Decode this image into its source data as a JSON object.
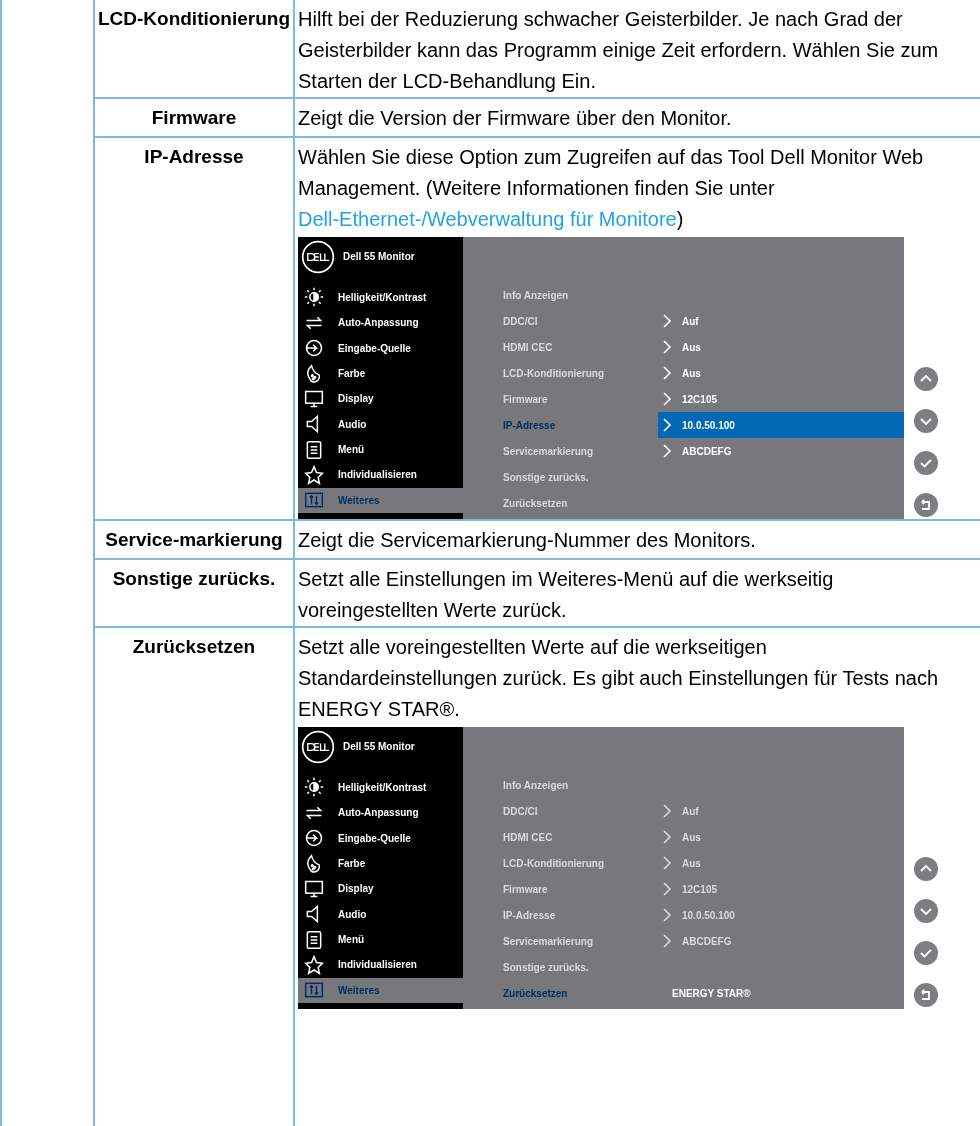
{
  "rows": [
    {
      "label": "LCD-Konditionierung",
      "description": [
        {
          "kind": "text",
          "text": "Hilft bei der Reduzierung schwacher Geisterbilder. Je nach Grad der Geisterbilder kann das Programm einige Zeit erfordern. Wählen Sie zum Starten der LCD-Behandlung Ein."
        }
      ]
    },
    {
      "label": "Firmware",
      "description": [
        {
          "kind": "text",
          "text": "Zeigt die Version der Firmware über den Monitor."
        }
      ]
    },
    {
      "label": "IP-Adresse",
      "description": [
        {
          "kind": "text",
          "text": "Wählen Sie diese Option zum Zugreifen auf das Tool Dell Monitor Web Management. (Weitere Informationen finden Sie unter "
        },
        {
          "kind": "link",
          "text": "Dell-Ethernet-/Webverwaltung für Monitore"
        },
        {
          "kind": "text",
          "text": ")"
        }
      ],
      "osd": {
        "title": "Dell 55 Monitor",
        "menu": [
          {
            "label": "Helligkeit/Kontrast",
            "selected": false
          },
          {
            "label": "Auto-Anpassung",
            "selected": false
          },
          {
            "label": "Eingabe-Quelle",
            "selected": false
          },
          {
            "label": "Farbe",
            "selected": false
          },
          {
            "label": "Display",
            "selected": false
          },
          {
            "label": "Audio",
            "selected": false
          },
          {
            "label": "Menü",
            "selected": false
          },
          {
            "label": "Individualisieren",
            "selected": false
          },
          {
            "label": "Weiteres",
            "selected": true
          }
        ],
        "submenu": [
          {
            "label": "Info Anzeigen",
            "selected": false
          },
          {
            "label": "DDC/CI",
            "selected": false,
            "value": "Auf",
            "chevron": true,
            "dimmed": false,
            "highlighted": false
          },
          {
            "label": "HDMI CEC",
            "selected": false,
            "value": "Aus",
            "chevron": true,
            "dimmed": false,
            "highlighted": false
          },
          {
            "label": "LCD-Konditionierung",
            "selected": false,
            "value": "Aus",
            "chevron": true,
            "dimmed": false,
            "highlighted": false
          },
          {
            "label": "Firmware",
            "selected": false,
            "value": "12C105",
            "chevron": true,
            "dimmed": false,
            "highlighted": false
          },
          {
            "label": "IP-Adresse",
            "selected": true,
            "value": "10.0.50.100",
            "chevron": true,
            "dimmed": false,
            "highlighted": true
          },
          {
            "label": "Servicemarkierung",
            "selected": false,
            "value": "ABCDEFG",
            "chevron": true,
            "dimmed": false,
            "highlighted": false
          },
          {
            "label": "Sonstige zurücks.",
            "selected": false
          },
          {
            "label": "Zurücksetzen",
            "selected": false
          }
        ]
      }
    },
    {
      "label": "Service-markierung",
      "description": [
        {
          "kind": "text",
          "text": "Zeigt die Servicemarkierung-Nummer des Monitors."
        }
      ]
    },
    {
      "label": "Sonstige zurücks.",
      "description": [
        {
          "kind": "text",
          "text": "Setzt alle Einstellungen im Weiteres-Menü auf die werkseitig voreingestellten Werte zurück."
        }
      ]
    },
    {
      "label": "Zurücksetzen",
      "description": [
        {
          "kind": "text",
          "text": "Setzt alle voreingestellten Werte auf die werkseitigen Standardeinstellungen zurück. Es gibt auch Einstellungen für Tests nach ENERGY STAR®."
        }
      ],
      "osd": {
        "title": "Dell 55 Monitor",
        "menu": [
          {
            "label": "Helligkeit/Kontrast",
            "selected": false
          },
          {
            "label": "Auto-Anpassung",
            "selected": false
          },
          {
            "label": "Eingabe-Quelle",
            "selected": false
          },
          {
            "label": "Farbe",
            "selected": false
          },
          {
            "label": "Display",
            "selected": false
          },
          {
            "label": "Audio",
            "selected": false
          },
          {
            "label": "Menü",
            "selected": false
          },
          {
            "label": "Individualisieren",
            "selected": false
          },
          {
            "label": "Weiteres",
            "selected": true
          }
        ],
        "submenu": [
          {
            "label": "Info Anzeigen",
            "selected": false
          },
          {
            "label": "DDC/CI",
            "selected": false,
            "value": "Auf",
            "chevron": true,
            "dimmed": true,
            "highlighted": false
          },
          {
            "label": "HDMI CEC",
            "selected": false,
            "value": "Aus",
            "chevron": true,
            "dimmed": true,
            "highlighted": false
          },
          {
            "label": "LCD-Konditionierung",
            "selected": false,
            "value": "Aus",
            "chevron": true,
            "dimmed": true,
            "highlighted": false
          },
          {
            "label": "Firmware",
            "selected": false,
            "value": "12C105",
            "chevron": true,
            "dimmed": true,
            "highlighted": false
          },
          {
            "label": "IP-Adresse",
            "selected": false,
            "value": "10.0.50.100",
            "chevron": true,
            "dimmed": true,
            "highlighted": false
          },
          {
            "label": "Servicemarkierung",
            "selected": false,
            "value": "ABCDEFG",
            "chevron": true,
            "dimmed": true,
            "highlighted": false
          },
          {
            "label": "Sonstige zurücks.",
            "selected": false
          },
          {
            "label": "Zurücksetzen",
            "selected": true,
            "value": "ENERGY STAR®",
            "chevron": false,
            "dimmed": false,
            "highlighted": false
          }
        ]
      }
    }
  ]
}
